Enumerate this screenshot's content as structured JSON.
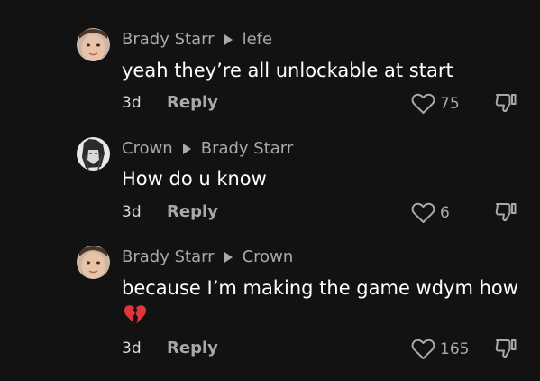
{
  "comments": [
    {
      "author": "Brady Starr",
      "reply_to": "lefe",
      "text": "yeah they’re all unlockable at start",
      "age": "3d",
      "reply_label": "Reply",
      "likes": "75",
      "avatar": "face-photo-avatar"
    },
    {
      "author": "Crown",
      "reply_to": "Brady Starr",
      "text": "How do u know",
      "age": "3d",
      "reply_label": "Reply",
      "likes": "6",
      "avatar": "anime-drawing-avatar"
    },
    {
      "author": "Brady Starr",
      "reply_to": "Crown",
      "text": "because I’m making the game wdym how",
      "emoji": "broken-heart-emoji",
      "age": "3d",
      "reply_label": "Reply",
      "likes": "165",
      "avatar": "face-photo-avatar"
    }
  ],
  "colors": {
    "background": "#121212",
    "username": "#a9a9a9",
    "text": "#ffffff",
    "broken_heart": "#e0353a"
  }
}
